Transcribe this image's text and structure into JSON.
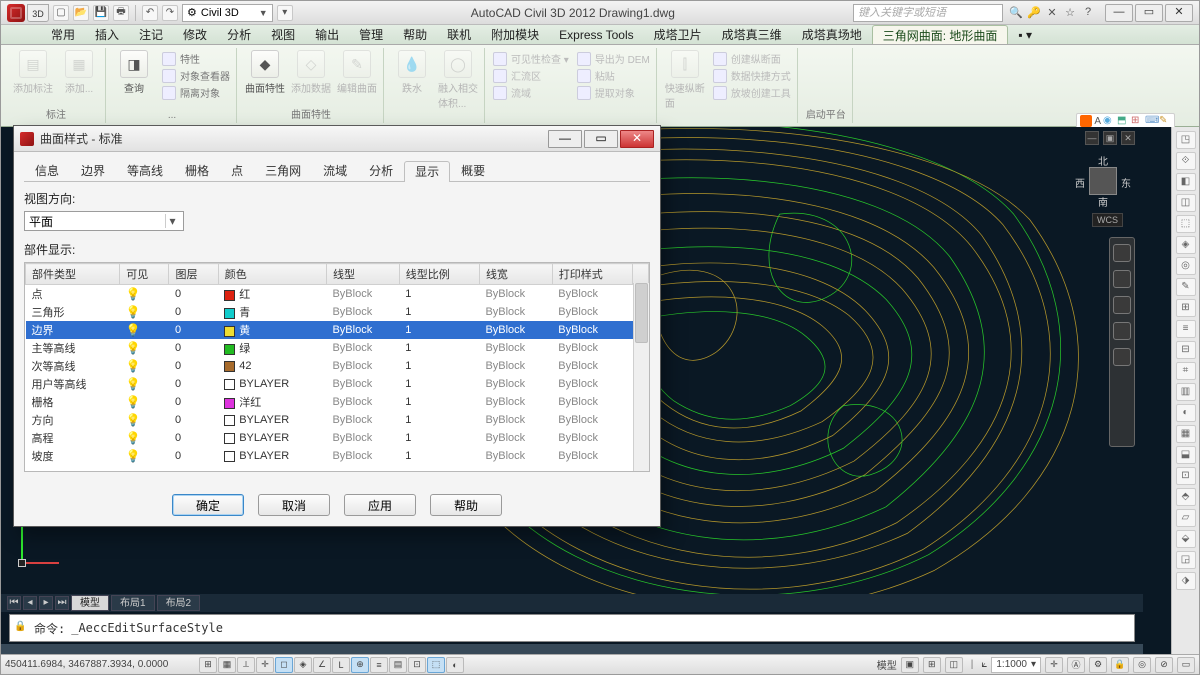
{
  "titlebar": {
    "btn3d": "3D",
    "workspace": "Civil 3D",
    "app_title": "AutoCAD Civil 3D 2012     Drawing1.dwg",
    "search_placeholder": "键入关键字或短语",
    "qat_icons": [
      "new",
      "open",
      "save",
      "print",
      "undo",
      "redo"
    ]
  },
  "menu": {
    "tabs": [
      "常用",
      "插入",
      "注记",
      "修改",
      "分析",
      "视图",
      "输出",
      "管理",
      "帮助",
      "联机",
      "附加模块",
      "Express Tools",
      "成塔卫片",
      "成塔真三维",
      "成塔真场地"
    ],
    "active_tab": "三角网曲面: 地形曲面"
  },
  "ribbon": {
    "groups": [
      {
        "label": "标注",
        "btns": [
          {
            "t": "添加标注",
            "ic": "▤",
            "dim": true
          },
          {
            "t": "添加...",
            "ic": "▦",
            "dim": true
          }
        ]
      },
      {
        "label": "...",
        "btns": [
          {
            "t": "查询",
            "ic": "◨"
          }
        ],
        "smalls": [
          {
            "t": "特性"
          },
          {
            "t": "对象查看器"
          },
          {
            "t": "隔离对象"
          }
        ]
      },
      {
        "label": "曲面特性",
        "btns": [
          {
            "t": "曲面特性",
            "ic": "◆"
          },
          {
            "t": "添加数据",
            "ic": "◇",
            "dim": true
          },
          {
            "t": "编辑曲面",
            "ic": "✎",
            "dim": true
          }
        ]
      },
      {
        "label": "",
        "btns": [
          {
            "t": "跌水",
            "ic": "💧",
            "dim": true
          },
          {
            "t": "融入相交体积...",
            "ic": "◯",
            "dim": true
          }
        ]
      },
      {
        "label": "",
        "smalls": [
          {
            "t": "可见性检查 ▾",
            "dim": true
          },
          {
            "t": "汇流区",
            "dim": true
          },
          {
            "t": "流域",
            "dim": true
          }
        ],
        "smalls2": [
          {
            "t": "导出为 DEM",
            "dim": true
          },
          {
            "t": "粘贴",
            "dim": true
          },
          {
            "t": "提取对象",
            "dim": true
          }
        ]
      },
      {
        "label": "",
        "btns": [
          {
            "t": "快速纵断面",
            "ic": "⫿",
            "dim": true
          }
        ],
        "smalls": [
          {
            "t": "创建纵断面",
            "dim": true
          },
          {
            "t": "数据快捷方式",
            "dim": true
          },
          {
            "t": "放坡创建工具",
            "dim": true
          }
        ]
      },
      {
        "label": "启动平台"
      }
    ]
  },
  "viewcube": {
    "n": "北",
    "s": "南",
    "e": "东",
    "w": "西",
    "wcs": "WCS"
  },
  "layout_tabs": {
    "items": [
      "模型",
      "布局1",
      "布局2"
    ],
    "active": 0
  },
  "command": {
    "prompt": "命令:",
    "text": "_AeccEditSurfaceStyle"
  },
  "status": {
    "coords": "450411.6984, 3467887.3934, 0.0000",
    "right_model": "模型",
    "scale": "1:1000"
  },
  "dialog": {
    "title": "曲面样式 - 标准",
    "tabs": [
      "信息",
      "边界",
      "等高线",
      "栅格",
      "点",
      "三角网",
      "流域",
      "分析",
      "显示",
      "概要"
    ],
    "active_tab": "显示",
    "viewdir_label": "视图方向:",
    "viewdir_value": "平面",
    "grid_label": "部件显示:",
    "columns": [
      "部件类型",
      "可见",
      "图层",
      "颜色",
      "线型",
      "线型比例",
      "线宽",
      "打印样式"
    ],
    "rows": [
      {
        "type": "点",
        "layer": "0",
        "color": "红",
        "sw": "#d21",
        "lt": "ByBlock",
        "lts": "1",
        "lw": "ByBlock",
        "ps": "ByBlock"
      },
      {
        "type": "三角形",
        "layer": "0",
        "color": "青",
        "sw": "#1cc",
        "lt": "ByBlock",
        "lts": "1",
        "lw": "ByBlock",
        "ps": "ByBlock"
      },
      {
        "type": "边界",
        "layer": "0",
        "color": "黄",
        "sw": "#ed3",
        "lt": "ByBlock",
        "lts": "1",
        "lw": "ByBlock",
        "ps": "ByBlock",
        "sel": true
      },
      {
        "type": "主等高线",
        "layer": "0",
        "color": "绿",
        "sw": "#2b2",
        "lt": "ByBlock",
        "lts": "1",
        "lw": "ByBlock",
        "ps": "ByBlock"
      },
      {
        "type": "次等高线",
        "layer": "0",
        "color": "42",
        "sw": "#a76b2c",
        "lt": "ByBlock",
        "lts": "1",
        "lw": "ByBlock",
        "ps": "ByBlock"
      },
      {
        "type": "用户等高线",
        "layer": "0",
        "color": "BYLAYER",
        "sw": "#fff",
        "lt": "ByBlock",
        "lts": "1",
        "lw": "ByBlock",
        "ps": "ByBlock"
      },
      {
        "type": "栅格",
        "layer": "0",
        "color": "洋红",
        "sw": "#d3d",
        "lt": "ByBlock",
        "lts": "1",
        "lw": "ByBlock",
        "ps": "ByBlock"
      },
      {
        "type": "方向",
        "layer": "0",
        "color": "BYLAYER",
        "sw": "#fff",
        "lt": "ByBlock",
        "lts": "1",
        "lw": "ByBlock",
        "ps": "ByBlock"
      },
      {
        "type": "高程",
        "layer": "0",
        "color": "BYLAYER",
        "sw": "#fff",
        "lt": "ByBlock",
        "lts": "1",
        "lw": "ByBlock",
        "ps": "ByBlock"
      },
      {
        "type": "坡度",
        "layer": "0",
        "color": "BYLAYER",
        "sw": "#fff",
        "lt": "ByBlock",
        "lts": "1",
        "lw": "ByBlock",
        "ps": "ByBlock"
      }
    ],
    "btn_ok": "确定",
    "btn_cancel": "取消",
    "btn_apply": "应用",
    "btn_help": "帮助"
  }
}
